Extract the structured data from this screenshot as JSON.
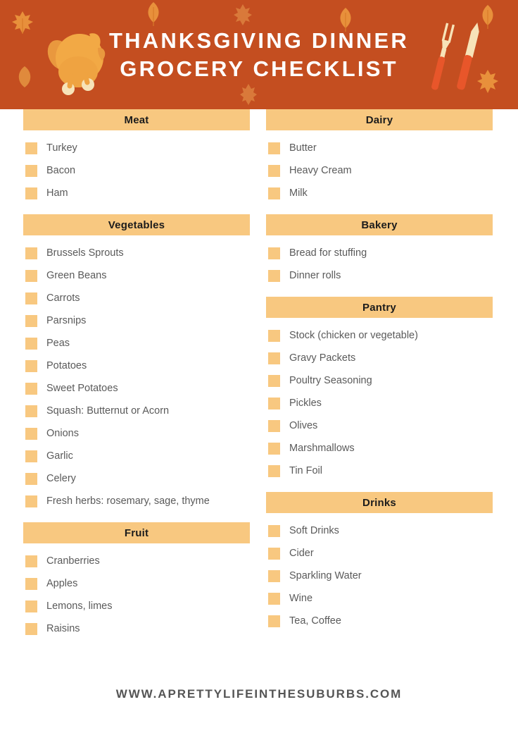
{
  "header": {
    "title_line1": "THANKSGIVING DINNER",
    "title_line2": "GROCERY CHECKLIST",
    "background_color": "#C44E20",
    "title_color": "#FFFFFF",
    "icons": {
      "turkey": "turkey-icon",
      "utensils": "carving-fork-and-knife-icon",
      "leaves": "autumn-leaf-icon"
    }
  },
  "theme": {
    "accent_orange": "#C44E20",
    "band_orange": "#F8C880",
    "text_gray": "#5A5A5A",
    "heading_black": "#1C1C1C",
    "page_background": "#FFFFFF"
  },
  "columns": {
    "left": [
      {
        "title": "Meat",
        "items": [
          "Turkey",
          "Bacon",
          "Ham"
        ]
      },
      {
        "title": "Vegetables",
        "items": [
          "Brussels Sprouts",
          "Green Beans",
          "Carrots",
          "Parsnips",
          "Peas",
          "Potatoes",
          "Sweet Potatoes",
          "Squash: Butternut or Acorn",
          "Onions",
          "Garlic",
          "Celery",
          "Fresh herbs: rosemary, sage, thyme"
        ]
      },
      {
        "title": "Fruit",
        "items": [
          "Cranberries",
          "Apples",
          "Lemons, limes",
          "Raisins"
        ]
      }
    ],
    "right": [
      {
        "title": "Dairy",
        "items": [
          "Butter",
          "Heavy Cream",
          "Milk"
        ]
      },
      {
        "title": "Bakery",
        "items": [
          "Bread for stuffing",
          "Dinner rolls"
        ]
      },
      {
        "title": "Pantry",
        "items": [
          "Stock (chicken or vegetable)",
          "Gravy Packets",
          "Poultry Seasoning",
          "Pickles",
          "Olives",
          "Marshmallows",
          "Tin Foil"
        ]
      },
      {
        "title": "Drinks",
        "items": [
          "Soft Drinks",
          "Cider",
          "Sparkling Water",
          "Wine",
          "Tea, Coffee"
        ]
      }
    ]
  },
  "footer": {
    "url": "WWW.APRETTYLIFEINTHESUBURBS.COM"
  }
}
